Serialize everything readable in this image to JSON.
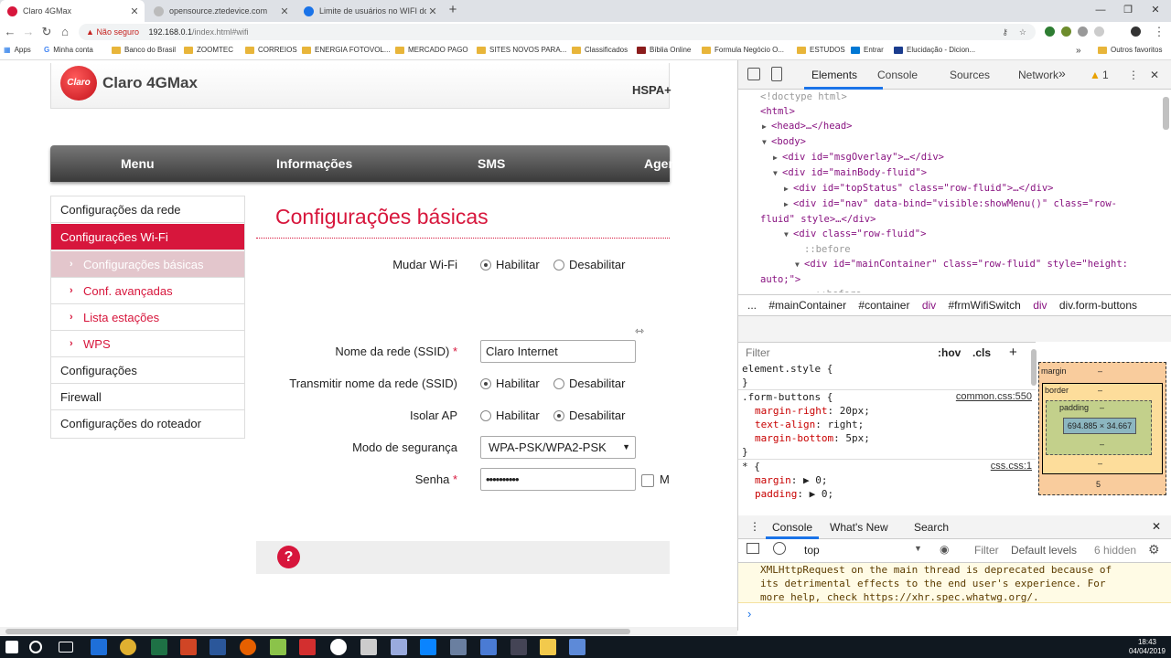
{
  "browser": {
    "tabs": [
      {
        "title": "Claro 4GMax",
        "active": true,
        "color": "#d7163c"
      },
      {
        "title": "opensource.ztedevice.com",
        "active": false,
        "color": "#888888"
      },
      {
        "title": "Limite de usuários no WIFI do rot",
        "active": false,
        "color": "#1a73e8"
      }
    ],
    "new_tab": "+",
    "security": "Não seguro",
    "host": "192.168.0.1",
    "path": "/index.html#wifi",
    "bookmarks": [
      "Apps",
      "Minha conta",
      "Banco do Brasil",
      "ZOOMTEC",
      "CORREIOS",
      "ENERGIA FOTOVOL...",
      "MERCADO PAGO",
      "SITES NOVOS PARA...",
      "Classificados",
      "Bíblia Online",
      "Formula Negócio O...",
      "ESTUDOS",
      "Entrar",
      "Elucidação - Dicion..."
    ],
    "more_bookmarks": "»",
    "other_bookmarks": "Outros favoritos"
  },
  "router": {
    "brand": "Claro 4GMax",
    "logo_text": "Claro",
    "network": "HSPA+",
    "menu": [
      "Menu",
      "Informações",
      "SMS",
      "Agen"
    ],
    "sidebar": [
      {
        "label": "Configurações da rede",
        "type": "main",
        "active": false
      },
      {
        "label": "Configurações Wi-Fi",
        "type": "main",
        "active": true
      },
      {
        "label": "Configurações básicas",
        "type": "sub",
        "active": true
      },
      {
        "label": "Conf. avançadas",
        "type": "sub",
        "active": false
      },
      {
        "label": "Lista estações",
        "type": "sub",
        "active": false
      },
      {
        "label": "WPS",
        "type": "sub",
        "active": false
      },
      {
        "label": "Configurações",
        "type": "main",
        "active": false
      },
      {
        "label": "Firewall",
        "type": "main",
        "active": false
      },
      {
        "label": "Configurações do roteador",
        "type": "main",
        "active": false
      }
    ],
    "page_title": "Configurações básicas",
    "form": {
      "wifi_switch": {
        "label": "Mudar Wi-Fi",
        "opt_on": "Habilitar",
        "opt_off": "Desabilitar",
        "selected": "on"
      },
      "ssid": {
        "label": "Nome da rede (SSID)",
        "required": "*",
        "value": "Claro Internet"
      },
      "broadcast": {
        "label": "Transmitir nome da rede (SSID)",
        "opt_on": "Habilitar",
        "opt_off": "Desabilitar",
        "selected": "on"
      },
      "isolate": {
        "label": "Isolar AP",
        "opt_on": "Habilitar",
        "opt_off": "Desabilitar",
        "selected": "off"
      },
      "security": {
        "label": "Modo de segurança",
        "value": "WPA-PSK/WPA2-PSK",
        "caret": "▼"
      },
      "password": {
        "label": "Senha",
        "required": "*",
        "value": "••••••••••",
        "show_label": "M"
      }
    },
    "help_icon": "?"
  },
  "devtools": {
    "tabs": [
      "Elements",
      "Console",
      "Sources",
      "Network"
    ],
    "more": "»",
    "warning_count": "1",
    "dom_lines": [
      {
        "indent": 0,
        "arrow": "",
        "text": "<!doctype html>",
        "kind": "cm"
      },
      {
        "indent": 0,
        "arrow": "",
        "text": "<html>",
        "kind": "tag"
      },
      {
        "indent": 1,
        "arrow": "▶",
        "text": "<head>…</head>",
        "kind": "tag"
      },
      {
        "indent": 1,
        "arrow": "▼",
        "text": "<body>",
        "kind": "tag"
      },
      {
        "indent": 2,
        "arrow": "▶",
        "text": "<div id=\"msgOverlay\">…</div>",
        "kind": "tag"
      },
      {
        "indent": 2,
        "arrow": "▼",
        "text": "<div id=\"mainBody-fluid\">",
        "kind": "tag"
      },
      {
        "indent": 3,
        "arrow": "▶",
        "text": "<div id=\"topStatus\" class=\"row-fluid\">…</div>",
        "kind": "tag"
      },
      {
        "indent": 3,
        "arrow": "▶",
        "text": "<div id=\"nav\" data-bind=\"visible:showMenu()\" class=\"row-",
        "kind": "tag"
      },
      {
        "indent": 0,
        "arrow": "",
        "text": "fluid\" style>…</div>",
        "kind": "tag"
      },
      {
        "indent": 3,
        "arrow": "▼",
        "text": "<div class=\"row-fluid\">",
        "kind": "tag"
      },
      {
        "indent": 4,
        "arrow": "",
        "text": "::before",
        "kind": "cm"
      },
      {
        "indent": 4,
        "arrow": "▼",
        "text": "<div id=\"mainContainer\" class=\"row-fluid\" style=\"height:",
        "kind": "tag"
      },
      {
        "indent": 0,
        "arrow": "",
        "text": "auto;\">",
        "kind": "tag"
      },
      {
        "indent": 5,
        "arrow": "",
        "text": "::before",
        "kind": "cm"
      }
    ],
    "breadcrumbs": [
      "...",
      "#mainContainer",
      "#container",
      "div",
      "#frmWifiSwitch",
      "div",
      "div.form-buttons"
    ],
    "filter_placeholder": "Filter",
    "hov": ":hov",
    "cls": ".cls",
    "add": "+",
    "styles": {
      "element_style": "element.style {",
      "close": "}",
      "rule_selector": ".form-buttons {",
      "rule_source": "common.css:550",
      "rule_props": [
        {
          "name": "margin-right",
          "value": "20px;"
        },
        {
          "name": "text-align",
          "value": "right;"
        },
        {
          "name": "margin-bottom",
          "value": "5px;"
        }
      ],
      "star_selector": "* {",
      "star_source": "css.css:1",
      "star_props": [
        {
          "name": "margin",
          "value": "▶ 0;"
        },
        {
          "name": "padding",
          "value": "▶ 0;"
        }
      ]
    },
    "box_model": {
      "margin": "margin",
      "border": "border",
      "padding": "padding",
      "dash": "–",
      "content": "694.885 × 34.667",
      "bottom": "5"
    },
    "console": {
      "tabs": [
        "Console",
        "What's New",
        "Search"
      ],
      "context": "top",
      "filter": "Filter",
      "levels": "Default levels",
      "hidden": "6 hidden",
      "message": "XMLHttpRequest on the main thread is deprecated because of\nits detrimental effects to the end user's experience. For\nmore help, check https://xhr.spec.whatwg.org/.",
      "prompt": "›"
    }
  },
  "taskbar": {
    "time": "18:43",
    "date": "04/04/2019"
  }
}
